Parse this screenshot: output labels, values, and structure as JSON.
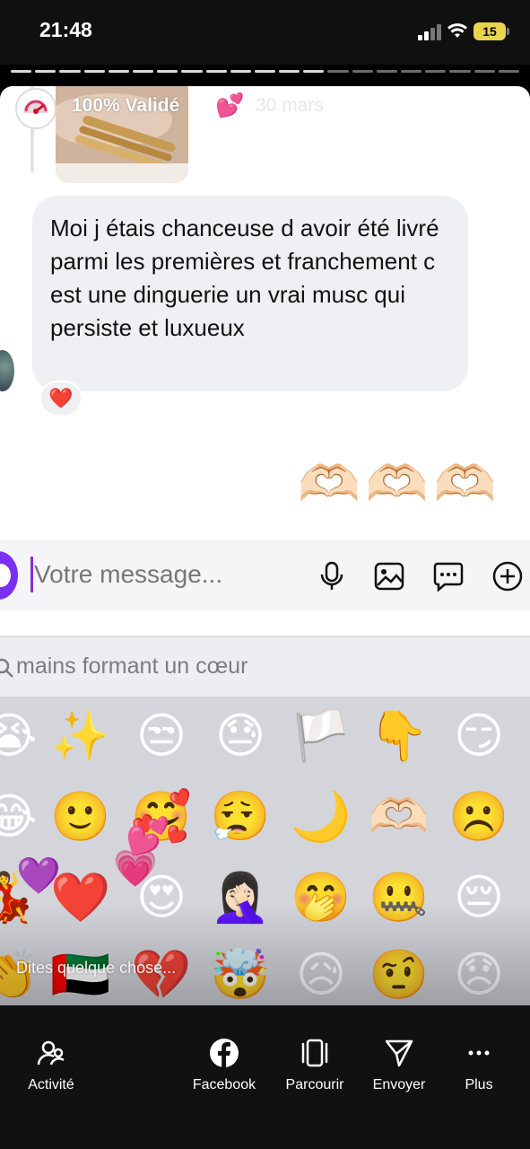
{
  "status_bar": {
    "time": "21:48",
    "battery_level": "15"
  },
  "story": {
    "progress_segments_total": 21,
    "progress_segments_done": 13,
    "username": "100% Validé",
    "username_emoji": "💕",
    "date": "30 mars",
    "more_icon": "•••"
  },
  "conversation": {
    "message_text": "Moi j étais chanceuse d avoir été livré parmi les premières et franchement c est une dinguerie un vrai musc qui persiste et luxueux",
    "reaction": "❤️",
    "sent_emojis": "🫶🏻🫶🏻🫶🏻"
  },
  "composer": {
    "placeholder": "Votre message...",
    "icons": [
      "mic-icon",
      "gallery-icon",
      "sticker-icon",
      "plus-icon"
    ]
  },
  "emoji_search": {
    "query": "mains formant un cœur"
  },
  "emoji_grid": {
    "rows": [
      [
        "😭",
        "✨",
        "😒",
        "😓",
        "🏳️",
        "👇",
        "😏"
      ],
      [
        "😂",
        "🙂",
        "🥰",
        "😮‍💨",
        "🌙",
        "🫶🏻",
        "☹️"
      ],
      [
        "💃",
        "❤️",
        "😍",
        "🤦🏻‍♀️",
        "🤭",
        "🤐",
        "😔"
      ],
      [
        "👏",
        "🇦🇪",
        "💔",
        "🤯",
        "😥",
        "🤨",
        "😞"
      ]
    ],
    "floating": [
      "💜",
      "💗",
      "💕"
    ],
    "overlay_text": "Dites quelque chose..."
  },
  "bottom_nav": {
    "items": [
      {
        "label": "Activité",
        "icon": "activity-icon"
      },
      {
        "label": "Facebook",
        "icon": "facebook-icon"
      },
      {
        "label": "Parcourir",
        "icon": "browse-icon"
      },
      {
        "label": "Envoyer",
        "icon": "send-icon"
      },
      {
        "label": "Plus",
        "icon": "more-icon"
      }
    ]
  },
  "colors": {
    "accent_purple": "#7b2ff0",
    "battery": "#e8d44d",
    "bubble": "#eff0f3",
    "keyboard": "#d3d5db"
  }
}
